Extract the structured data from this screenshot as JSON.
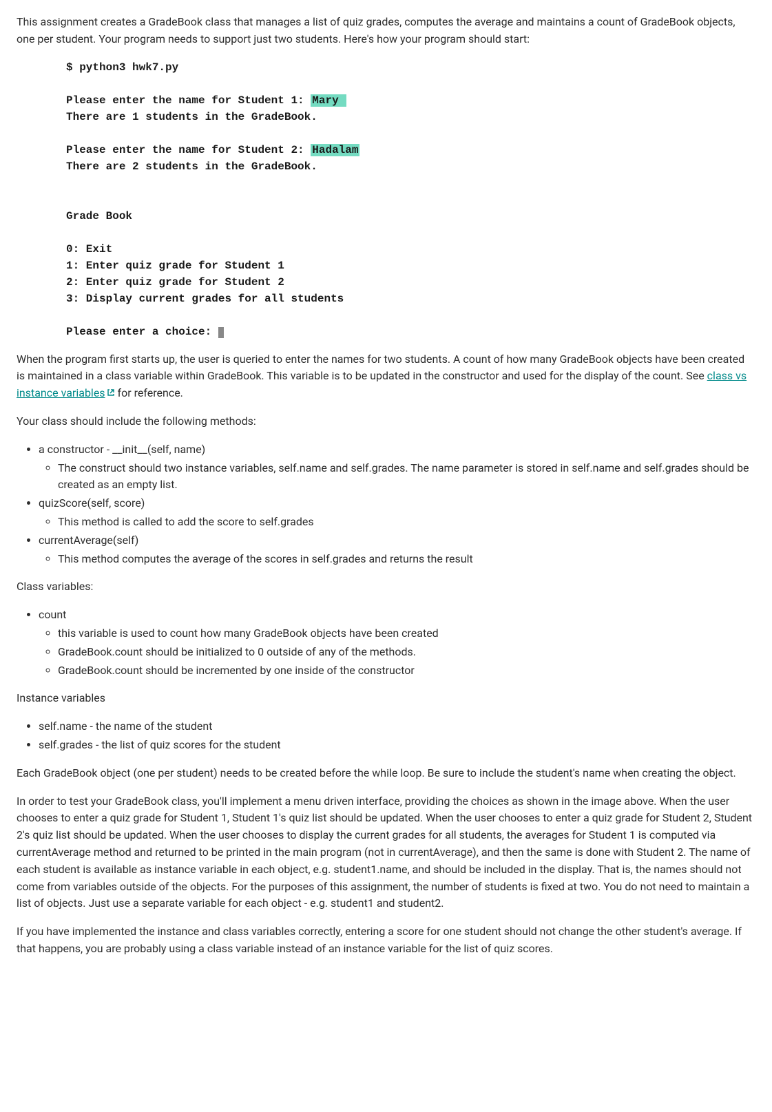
{
  "intro": "This assignment creates a GradeBook class that manages a list of quiz grades, computes the average and maintains a count of GradeBook objects, one per student. Your program needs to support just two students. Here's how your program should start:",
  "code": {
    "line1": "$ python3 hwk7.py",
    "line2a": "Please enter the name for Student 1: ",
    "line2_hl": "Mary ",
    "line3": "There are 1 students in the GradeBook.",
    "line4a": "Please enter the name for Student 2: ",
    "line4_hl": "Hadalam",
    "line5": "There are 2 students in the GradeBook.",
    "line6": "Grade Book",
    "line7": "0: Exit",
    "line8": "1: Enter quiz grade for Student 1",
    "line9": "2: Enter quiz grade for Student 2",
    "line10": "3: Display current grades for all students",
    "line11": "Please enter a choice: "
  },
  "para2a": "When the program first starts up, the user is queried to enter the names for two students. A count of how many GradeBook objects have been created is maintained in a class variable within GradeBook. This variable is to be updated in the constructor and used for the display of the count. See ",
  "link_text": "class vs instance variables",
  "para2b": " for reference.",
  "methods_intro": "Your class should include the following methods:",
  "methods": [
    {
      "top": "a constructor - __init__(self, name)",
      "subs": [
        "The construct should two instance variables, self.name and self.grades. The name parameter is stored in self.name and self.grades should be created as an empty list."
      ]
    },
    {
      "top": "quizScore(self, score)",
      "subs": [
        "This method is called to add the score to self.grades"
      ]
    },
    {
      "top": "currentAverage(self)",
      "subs": [
        "This method computes the average of the scores in self.grades and returns the result"
      ]
    }
  ],
  "classvars_heading": "Class variables:",
  "classvars": [
    {
      "top": "count",
      "subs": [
        "this variable is used to count how many GradeBook objects have been created",
        "GradeBook.count should be initialized to 0 outside of any of the methods.",
        "GradeBook.count should be incremented by one inside of the constructor"
      ]
    }
  ],
  "instancevars_heading": "Instance variables",
  "instancevars": [
    {
      "top": "self.name - the name of the student"
    },
    {
      "top": "self.grades - the list of quiz scores for the student"
    }
  ],
  "para_each": "Each GradeBook object (one per student) needs to be created before the while loop. Be sure to include the student's name when creating the object.",
  "para_test": "In order to test your GradeBook class, you'll implement a menu driven interface, providing the choices as shown in the image above. When the user chooses to enter a quiz grade for Student 1, Student 1's quiz list should be updated. When the user chooses to enter a quiz grade for Student 2, Student 2's quiz list should be updated. When the user chooses to display the current grades for all students, the averages for Student 1 is computed via currentAverage method and returned to be printed in the main program (not in currentAverage), and then the same is done with Student 2. The name of each student is available as instance variable in each object, e.g. student1.name,  and should be included in the display. That is, the names should not come from variables outside of the objects. For the purposes of this assignment, the number of students is fixed at two. You do not need to maintain a list of objects. Just use a separate variable for each object - e.g. student1 and student2.",
  "para_impl": "If you have implemented the instance and class variables correctly, entering a score for one student should not change the other student's average. If that happens, you are probably using a class variable instead of an instance variable for the list of quiz scores."
}
